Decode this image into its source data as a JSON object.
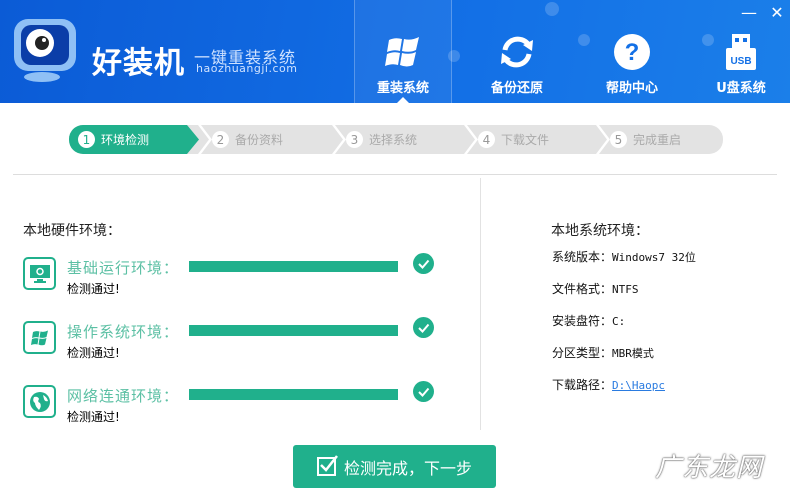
{
  "header": {
    "brand": "好装机",
    "slogan": "一键重装系统",
    "domain": "haozhuangji.com",
    "nav": [
      {
        "label": "重装系统",
        "icon": "windows-icon",
        "active": true
      },
      {
        "label": "备份还原",
        "icon": "refresh-icon",
        "active": false
      },
      {
        "label": "帮助中心",
        "icon": "help-icon",
        "active": false
      },
      {
        "label": "U盘系统",
        "icon": "usb-icon",
        "active": false
      }
    ],
    "usb_text": "USB",
    "help_glyph": "?",
    "minimize": "—",
    "close": "✕"
  },
  "steps": [
    {
      "num": "1",
      "label": "环境检测",
      "active": true
    },
    {
      "num": "2",
      "label": "备份资料",
      "active": false
    },
    {
      "num": "3",
      "label": "选择系统",
      "active": false
    },
    {
      "num": "4",
      "label": "下载文件",
      "active": false
    },
    {
      "num": "5",
      "label": "完成重启",
      "active": false
    }
  ],
  "hardware": {
    "title": "本地硬件环境：",
    "checks": [
      {
        "label": "基础运行环境：",
        "status": "检测通过!",
        "progress": 100
      },
      {
        "label": "操作系统环境：",
        "status": "检测通过!",
        "progress": 100
      },
      {
        "label": "网络连通环境：",
        "status": "检测通过!",
        "progress": 100
      }
    ]
  },
  "system": {
    "title": "本地系统环境：",
    "items": [
      {
        "label": "系统版本：",
        "value": "Windows7  32位"
      },
      {
        "label": "文件格式：",
        "value": "NTFS"
      },
      {
        "label": "安装盘符：",
        "value": "C:"
      },
      {
        "label": "分区类型：",
        "value": "MBR模式"
      },
      {
        "label": "下载路径：",
        "value": "D:\\Haopc"
      }
    ]
  },
  "next_button": "检测完成，下一步",
  "watermark": "广东龙网",
  "colors": {
    "accent": "#20b08c",
    "header": "#1370e6",
    "link": "#2a7be0"
  }
}
